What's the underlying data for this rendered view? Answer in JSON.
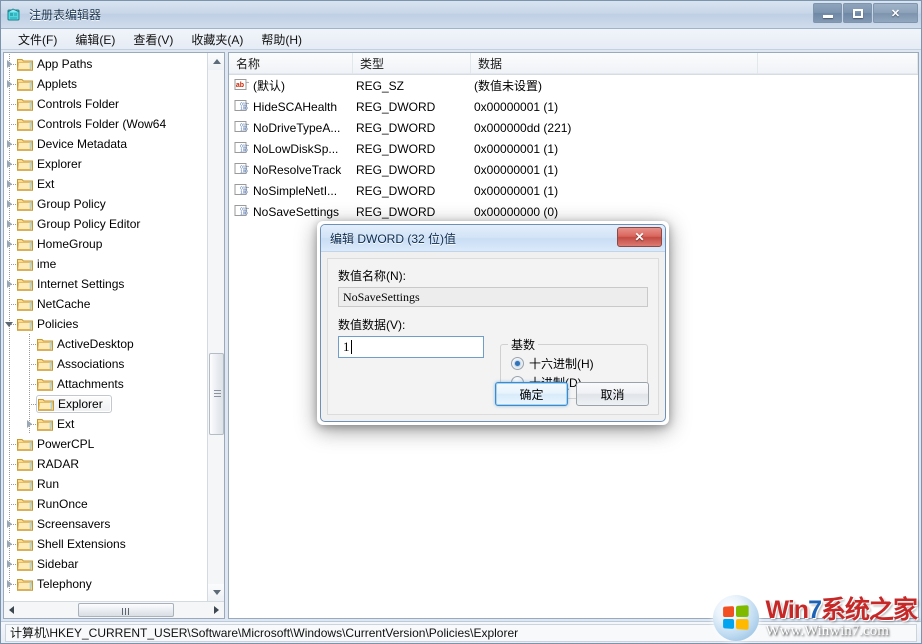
{
  "window": {
    "title": "注册表编辑器",
    "app_icon": "regedit-icon",
    "controls": {
      "minimize": "最小化",
      "maximize": "最大化",
      "close": "关闭",
      "close_glyph": "✕"
    }
  },
  "menubar": {
    "items": [
      {
        "label": "文件(F)",
        "name": "menu-file"
      },
      {
        "label": "编辑(E)",
        "name": "menu-edit"
      },
      {
        "label": "查看(V)",
        "name": "menu-view"
      },
      {
        "label": "收藏夹(A)",
        "name": "menu-favorites"
      },
      {
        "label": "帮助(H)",
        "name": "menu-help"
      }
    ]
  },
  "tree": {
    "nodes": [
      {
        "label": "App Paths",
        "depth": 1,
        "state": "collapsed"
      },
      {
        "label": "Applets",
        "depth": 1,
        "state": "collapsed"
      },
      {
        "label": "Controls Folder",
        "depth": 1,
        "state": "leaf"
      },
      {
        "label": "Controls Folder (Wow64",
        "depth": 1,
        "state": "leaf"
      },
      {
        "label": "Device Metadata",
        "depth": 1,
        "state": "collapsed"
      },
      {
        "label": "Explorer",
        "depth": 1,
        "state": "collapsed"
      },
      {
        "label": "Ext",
        "depth": 1,
        "state": "collapsed"
      },
      {
        "label": "Group Policy",
        "depth": 1,
        "state": "collapsed"
      },
      {
        "label": "Group Policy Editor",
        "depth": 1,
        "state": "collapsed"
      },
      {
        "label": "HomeGroup",
        "depth": 1,
        "state": "collapsed"
      },
      {
        "label": "ime",
        "depth": 1,
        "state": "leaf"
      },
      {
        "label": "Internet Settings",
        "depth": 1,
        "state": "collapsed"
      },
      {
        "label": "NetCache",
        "depth": 1,
        "state": "leaf"
      },
      {
        "label": "Policies",
        "depth": 1,
        "state": "expanded"
      },
      {
        "label": "ActiveDesktop",
        "depth": 2,
        "state": "leaf"
      },
      {
        "label": "Associations",
        "depth": 2,
        "state": "leaf"
      },
      {
        "label": "Attachments",
        "depth": 2,
        "state": "leaf"
      },
      {
        "label": "Explorer",
        "depth": 2,
        "state": "leaf",
        "selected": true
      },
      {
        "label": "Ext",
        "depth": 2,
        "state": "collapsed"
      },
      {
        "label": "PowerCPL",
        "depth": 1,
        "state": "leaf"
      },
      {
        "label": "RADAR",
        "depth": 1,
        "state": "leaf"
      },
      {
        "label": "Run",
        "depth": 1,
        "state": "leaf"
      },
      {
        "label": "RunOnce",
        "depth": 1,
        "state": "leaf"
      },
      {
        "label": "Screensavers",
        "depth": 1,
        "state": "collapsed"
      },
      {
        "label": "Shell Extensions",
        "depth": 1,
        "state": "collapsed"
      },
      {
        "label": "Sidebar",
        "depth": 1,
        "state": "collapsed"
      },
      {
        "label": "Telephony",
        "depth": 1,
        "state": "collapsed"
      }
    ]
  },
  "list": {
    "columns": [
      {
        "label": "名称",
        "name": "column-name"
      },
      {
        "label": "类型",
        "name": "column-type"
      },
      {
        "label": "数据",
        "name": "column-data"
      }
    ],
    "rows": [
      {
        "name": "(默认)",
        "type": "REG_SZ",
        "data": "(数值未设置)",
        "icon": "string-value-icon"
      },
      {
        "name": "HideSCAHealth",
        "type": "REG_DWORD",
        "data": "0x00000001 (1)",
        "icon": "dword-value-icon"
      },
      {
        "name": "NoDriveTypeA...",
        "type": "REG_DWORD",
        "data": "0x000000dd (221)",
        "icon": "dword-value-icon"
      },
      {
        "name": "NoLowDiskSp...",
        "type": "REG_DWORD",
        "data": "0x00000001 (1)",
        "icon": "dword-value-icon"
      },
      {
        "name": "NoResolveTrack",
        "type": "REG_DWORD",
        "data": "0x00000001 (1)",
        "icon": "dword-value-icon"
      },
      {
        "name": "NoSimpleNetI...",
        "type": "REG_DWORD",
        "data": "0x00000001 (1)",
        "icon": "dword-value-icon"
      },
      {
        "name": "NoSaveSettings",
        "type": "REG_DWORD",
        "data": "0x00000000 (0)",
        "icon": "dword-value-icon"
      }
    ]
  },
  "statusbar": {
    "path": "计算机\\HKEY_CURRENT_USER\\Software\\Microsoft\\Windows\\CurrentVersion\\Policies\\Explorer"
  },
  "watermark": {
    "brand_prefix": "Win",
    "brand_seven": "7",
    "brand_suffix": "系统之家",
    "url": "Www.Winwin7.com"
  },
  "dialog": {
    "title": "编辑 DWORD (32 位)值",
    "close_glyph": "✕",
    "name_label": "数值名称(N):",
    "name_value": "NoSaveSettings",
    "data_label": "数值数据(V):",
    "data_value": "1",
    "base_legend": "基数",
    "radios": [
      {
        "label": "十六进制(H)",
        "selected": true,
        "name": "radio-hexadecimal"
      },
      {
        "label": "十进制(D)",
        "selected": false,
        "name": "radio-decimal"
      }
    ],
    "ok_label": "确定",
    "cancel_label": "取消"
  },
  "colors": {
    "accent": "#2f72b8",
    "close_red": "#c24b43",
    "folder_yellow": "#ffd27a",
    "title_text": "#1b3550"
  }
}
